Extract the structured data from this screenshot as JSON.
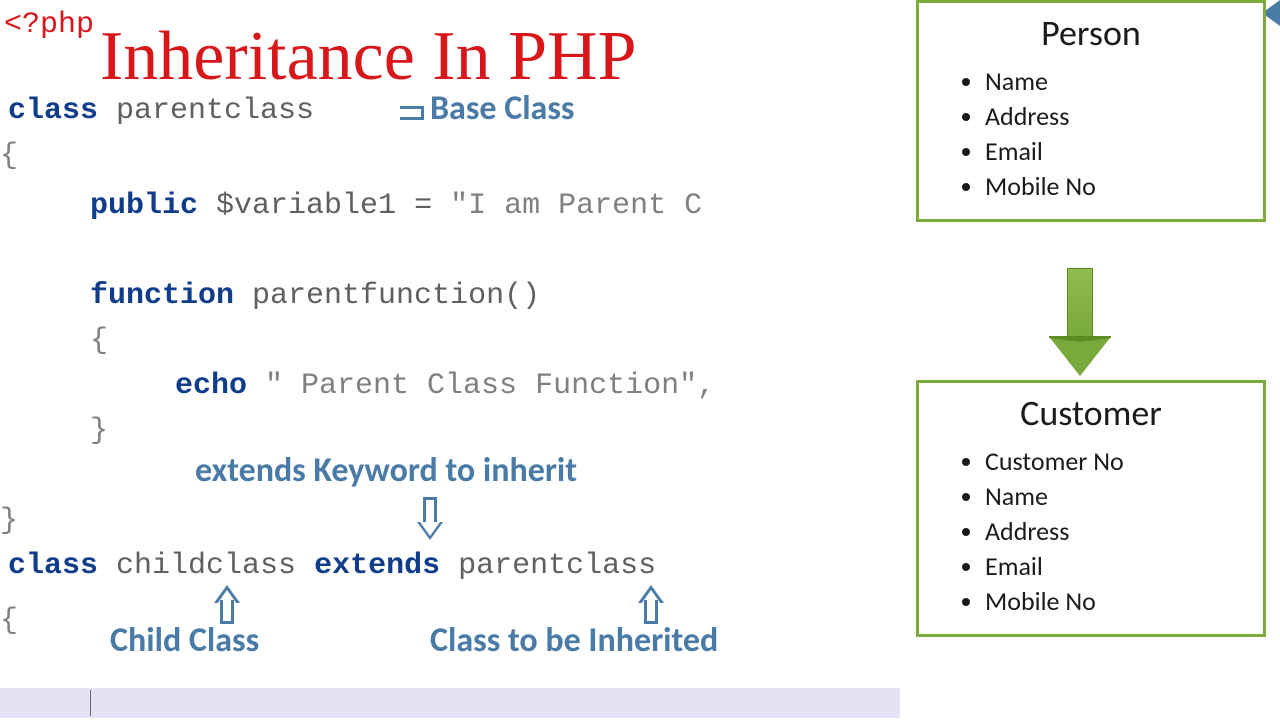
{
  "title": "Inheritance In PHP",
  "code": {
    "php_open": "<?php",
    "kw_class1": "class",
    "parentclass": " parentclass",
    "brace_open1": "{",
    "kw_public": "public",
    "var_decl": " $variable1 ",
    "eq": "= ",
    "str1": "\"I am Parent C",
    "kw_function": "function",
    "func_name": " parentfunction",
    "parens": "()",
    "brace_open2": "{",
    "kw_echo": "echo",
    "str2": " \" Parent Class Function\",",
    "brace_close2": "}",
    "brace_close1": "}",
    "kw_class2": "class",
    "childclass": " childclass ",
    "kw_extends": "extends",
    "parentclass2": " parentclass",
    "brace_open3": "{"
  },
  "annotations": {
    "base": "Base Class",
    "extends": "extends Keyword to inherit",
    "child": "Child Class",
    "inherited": "Class to be Inherited"
  },
  "diagram": {
    "person": {
      "title": "Person",
      "items": [
        "Name",
        "Address",
        "Email",
        "Mobile No"
      ]
    },
    "customer": {
      "title": "Customer",
      "items": [
        "Customer No",
        "Name",
        "Address",
        "Email",
        "Mobile No"
      ]
    }
  }
}
